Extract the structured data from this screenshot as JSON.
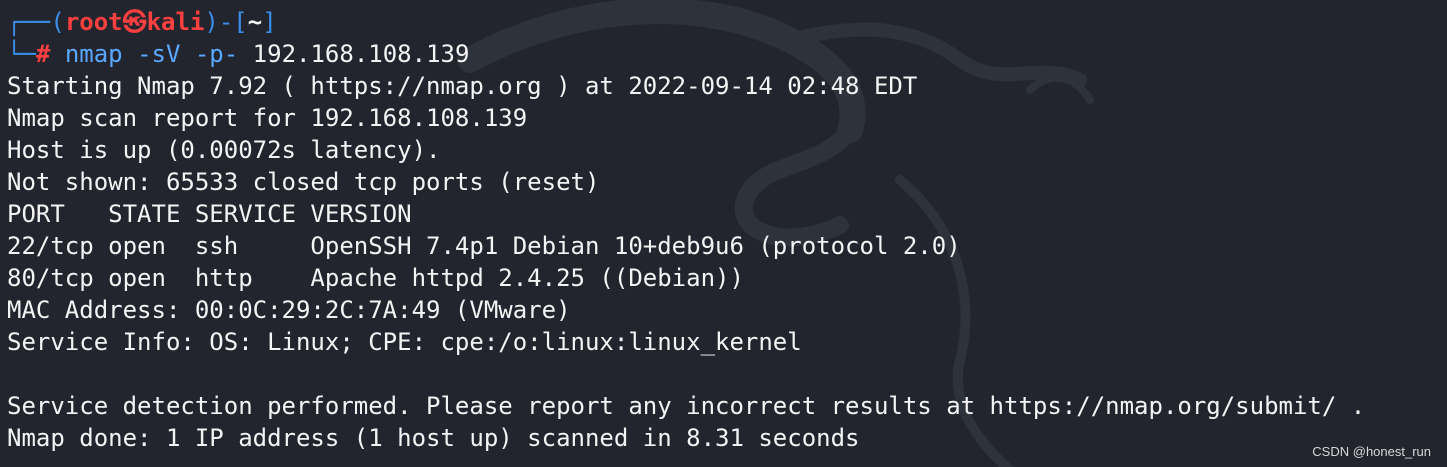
{
  "prompt": {
    "corner_top": "┌──",
    "open_paren": "(",
    "user": "root",
    "at_symbol": "㉿",
    "host": "kali",
    "close_paren": ")",
    "dash_bracket_open": "-[",
    "path": "~",
    "bracket_close": "]",
    "corner_bottom": "└─",
    "hash": "#"
  },
  "command": {
    "name": "nmap",
    "flags": "-sV -p-",
    "target": "192.168.108.139"
  },
  "output": [
    "Starting Nmap 7.92 ( https://nmap.org ) at 2022-09-14 02:48 EDT",
    "Nmap scan report for 192.168.108.139",
    "Host is up (0.00072s latency).",
    "Not shown: 65533 closed tcp ports (reset)",
    "PORT   STATE SERVICE VERSION",
    "22/tcp open  ssh     OpenSSH 7.4p1 Debian 10+deb9u6 (protocol 2.0)",
    "80/tcp open  http    Apache httpd 2.4.25 ((Debian))",
    "MAC Address: 00:0C:29:2C:7A:49 (VMware)",
    "Service Info: OS: Linux; CPE: cpe:/o:linux:linux_kernel",
    "",
    "Service detection performed. Please report any incorrect results at https://nmap.org/submit/ .",
    "Nmap done: 1 IP address (1 host up) scanned in 8.31 seconds"
  ],
  "watermark": "CSDN @honest_run",
  "colors": {
    "background": "#22252d",
    "prompt_frame": "#3b8eea",
    "prompt_user": "#ff4040",
    "command": "#5aa7ff",
    "text": "#f4f4f4"
  }
}
